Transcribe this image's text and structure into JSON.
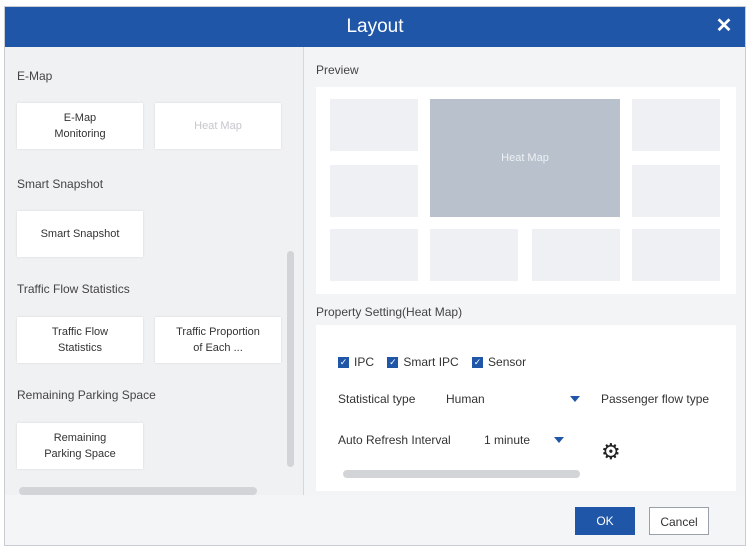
{
  "dialog": {
    "title": "Layout",
    "close_glyph": "✕"
  },
  "left": {
    "sections": [
      {
        "title": "E-Map",
        "cards": [
          {
            "label": "E-Map\nMonitoring",
            "enabled": true
          },
          {
            "label": "Heat Map",
            "enabled": false
          }
        ]
      },
      {
        "title": "Smart Snapshot",
        "cards": [
          {
            "label": "Smart Snapshot",
            "enabled": true
          }
        ]
      },
      {
        "title": "Traffic Flow Statistics",
        "cards": [
          {
            "label": "Traffic Flow\nStatistics",
            "enabled": true
          },
          {
            "label": "Traffic Proportion\nof Each ...",
            "enabled": true
          }
        ]
      },
      {
        "title": "Remaining Parking Space",
        "cards": [
          {
            "label": "Remaining\nParking Space",
            "enabled": true
          }
        ]
      }
    ]
  },
  "preview": {
    "title": "Preview",
    "selected_cell_label": "Heat Map"
  },
  "property": {
    "title": "Property Setting(Heat Map)",
    "checkboxes": [
      "IPC",
      "Smart IPC",
      "Sensor"
    ],
    "statistical_type_label": "Statistical type",
    "statistical_type_value": "Human",
    "passenger_flow_label": "Passenger flow type",
    "refresh_label": "Auto Refresh Interval",
    "refresh_value": "1 minute",
    "check_glyph": "✓",
    "gear_glyph": "⚙"
  },
  "footer": {
    "ok_label": "OK",
    "cancel_label": "Cancel"
  },
  "colors": {
    "accent": "#1f56a8"
  },
  "icons": {
    "close": "close-icon",
    "checkbox": "checkbox-checked-icon",
    "dropdown": "caret-down-icon",
    "settings": "gear-icon"
  }
}
